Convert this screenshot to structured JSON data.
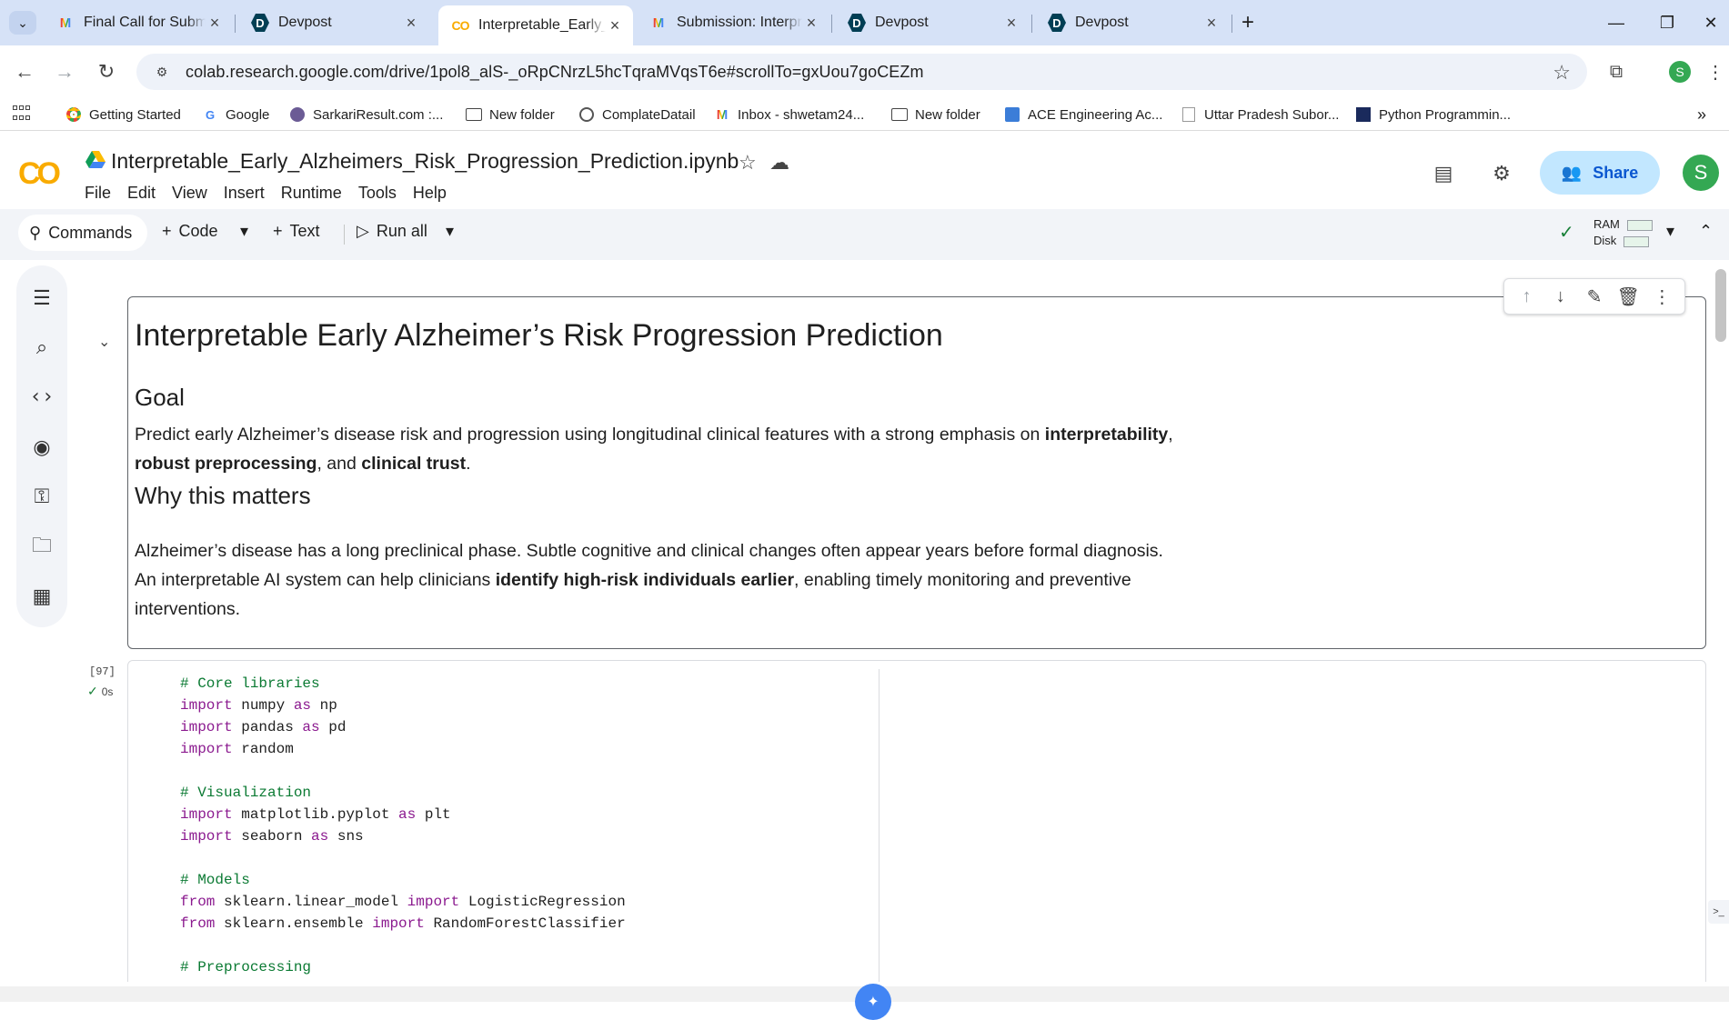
{
  "browser": {
    "tabs": [
      {
        "icon": "gmail-icon",
        "title": "Final Call for Submissions!!"
      },
      {
        "icon": "devpost-icon",
        "title": "Devpost"
      },
      {
        "icon": "colab-icon",
        "title": "Interpretable_Early_Alzheimers",
        "active": true
      },
      {
        "icon": "gmail-icon",
        "title": "Submission: Interpretable Alzheimers"
      },
      {
        "icon": "devpost-icon",
        "title": "Devpost"
      },
      {
        "icon": "devpost-icon",
        "title": "Devpost"
      }
    ],
    "url": "colab.research.google.com/drive/1pol8_alS-_oRpCNrzL5hcTqraMVqsT6e#scrollTo=gxUou7goCEZm",
    "profile_initial": "S",
    "bookmarks": [
      {
        "icon": "chrome-icon",
        "label": "Getting Started"
      },
      {
        "icon": "google-icon",
        "label": "Google"
      },
      {
        "icon": "site-icon",
        "label": "SarkariResult.com :..."
      },
      {
        "icon": "folder-icon",
        "label": "New folder"
      },
      {
        "icon": "site-icon",
        "label": "ComplateDatail"
      },
      {
        "icon": "gmail-icon",
        "label": "Inbox - shwetam24..."
      },
      {
        "icon": "folder-icon",
        "label": "New folder"
      },
      {
        "icon": "site-icon",
        "label": "ACE Engineering Ac..."
      },
      {
        "icon": "page-icon",
        "label": "Uttar Pradesh Subor..."
      },
      {
        "icon": "site-icon",
        "label": "Python Programmin..."
      }
    ]
  },
  "colab": {
    "notebook_title": "Interpretable_Early_Alzheimers_Risk_Progression_Prediction.ipynb",
    "menu": [
      "File",
      "Edit",
      "View",
      "Insert",
      "Runtime",
      "Tools",
      "Help"
    ],
    "share_label": "Share",
    "avatar_initial": "S",
    "toolbar": {
      "commands": "Commands",
      "code": "Code",
      "text": "Text",
      "run_all": "Run all",
      "ram": "RAM",
      "disk": "Disk"
    }
  },
  "text_cell": {
    "title": "Interpretable Early Alzheimer’s Risk Progression Prediction",
    "goal_heading": "Goal",
    "goal_p1_a": "Predict early Alzheimer’s disease risk and progression using longitudinal clinical features with a strong emphasis on ",
    "goal_p1_b": "interpretability",
    "goal_p1_c": ",",
    "goal_p2_a": "robust preprocessing",
    "goal_p2_b": ", and ",
    "goal_p2_c": "clinical trust",
    "goal_p2_d": ".",
    "why_heading": "Why this matters",
    "why_l1": "Alzheimer’s disease has a long preclinical phase. Subtle cognitive and clinical changes often appear years before formal diagnosis.",
    "why_l2_a": "An interpretable AI system can help clinicians ",
    "why_l2_b": "identify high-risk individuals earlier",
    "why_l2_c": ", enabling timely monitoring and preventive",
    "why_l3": "interventions."
  },
  "code_cell": {
    "exec_count": "[97]",
    "exec_time": "0s",
    "lines": [
      [
        {
          "t": "cm",
          "v": "# Core libraries"
        }
      ],
      [
        {
          "t": "kw",
          "v": "import"
        },
        {
          "t": "",
          "v": " numpy "
        },
        {
          "t": "kw",
          "v": "as"
        },
        {
          "t": "",
          "v": " np"
        }
      ],
      [
        {
          "t": "kw",
          "v": "import"
        },
        {
          "t": "",
          "v": " pandas "
        },
        {
          "t": "kw",
          "v": "as"
        },
        {
          "t": "",
          "v": " pd"
        }
      ],
      [
        {
          "t": "kw",
          "v": "import"
        },
        {
          "t": "",
          "v": " random"
        }
      ],
      [],
      [
        {
          "t": "cm",
          "v": "# Visualization"
        }
      ],
      [
        {
          "t": "kw",
          "v": "import"
        },
        {
          "t": "",
          "v": " matplotlib.pyplot "
        },
        {
          "t": "kw",
          "v": "as"
        },
        {
          "t": "",
          "v": " plt"
        }
      ],
      [
        {
          "t": "kw",
          "v": "import"
        },
        {
          "t": "",
          "v": " seaborn "
        },
        {
          "t": "kw",
          "v": "as"
        },
        {
          "t": "",
          "v": " sns"
        }
      ],
      [],
      [
        {
          "t": "cm",
          "v": "# Models"
        }
      ],
      [
        {
          "t": "kw",
          "v": "from"
        },
        {
          "t": "",
          "v": " sklearn.linear_model "
        },
        {
          "t": "kw",
          "v": "import"
        },
        {
          "t": "",
          "v": " LogisticRegression"
        }
      ],
      [
        {
          "t": "kw",
          "v": "from"
        },
        {
          "t": "",
          "v": " sklearn.ensemble "
        },
        {
          "t": "kw",
          "v": "import"
        },
        {
          "t": "",
          "v": " RandomForestClassifier"
        }
      ],
      [],
      [
        {
          "t": "cm",
          "v": "# Preprocessing"
        }
      ]
    ]
  }
}
